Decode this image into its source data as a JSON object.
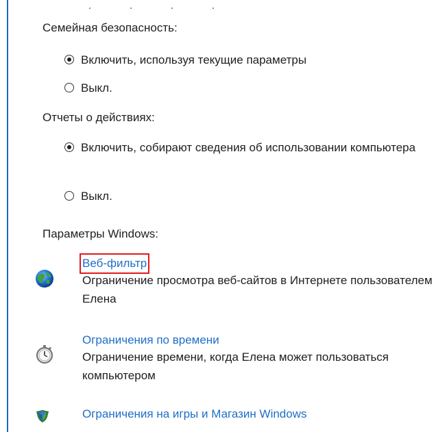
{
  "family_safety": {
    "title": "Семейная безопасность:",
    "options": [
      {
        "label": "Включить, используя текущие параметры",
        "checked": true
      },
      {
        "label": "Выкл.",
        "checked": false
      }
    ]
  },
  "activity_reports": {
    "title": "Отчеты о действиях:",
    "options": [
      {
        "label": "Включить, собирают сведения об использовании компьютера",
        "checked": true
      },
      {
        "label": "Выкл.",
        "checked": false
      }
    ]
  },
  "windows_settings": {
    "title": "Параметры Windows:",
    "items": [
      {
        "icon": "globe-icon",
        "link": "Веб-фильтр",
        "description": "Ограничение просмотра веб-сайтов в Интернете пользователем Елена",
        "highlighted": true
      },
      {
        "icon": "stopwatch-icon",
        "link": "Ограничения по времени",
        "description": "Ограничение времени, когда Елена может пользоваться компьютером",
        "highlighted": false
      },
      {
        "icon": "shield-icon",
        "link": "Ограничения на игры и Магазин Windows",
        "description": "",
        "highlighted": false
      }
    ]
  },
  "colors": {
    "link": "#1e6ec8",
    "highlight_border": "#e01a1a",
    "window_border": "#1a69b9"
  }
}
